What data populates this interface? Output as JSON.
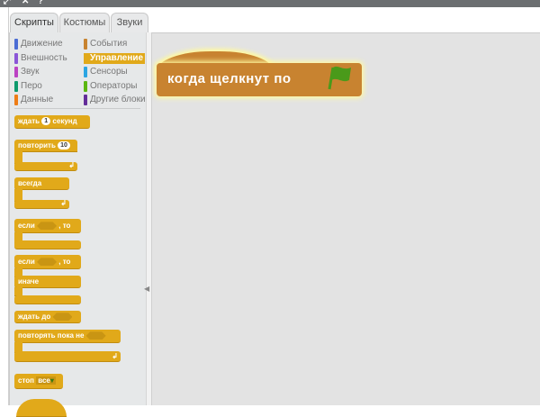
{
  "tabs": [
    {
      "label": "Скрипты"
    },
    {
      "label": "Костюмы"
    },
    {
      "label": "Звуки"
    }
  ],
  "categories": [
    {
      "label": "Движение",
      "color": "#4a6cd4"
    },
    {
      "label": "События",
      "color": "#c88330"
    },
    {
      "label": "Внешность",
      "color": "#8a55d7"
    },
    {
      "label": "Управление",
      "color": "#e1a91a"
    },
    {
      "label": "Звук",
      "color": "#bb42c3"
    },
    {
      "label": "Сенсоры",
      "color": "#2ca5e2"
    },
    {
      "label": "Перо",
      "color": "#0e9a6c"
    },
    {
      "label": "Операторы",
      "color": "#5cb712"
    },
    {
      "label": "Данные",
      "color": "#ee7d16"
    },
    {
      "label": "Другие блоки",
      "color": "#632d99"
    }
  ],
  "blocks": {
    "wait": {
      "label": "ждать",
      "value": "1",
      "suffix": "секунд"
    },
    "repeat": {
      "label": "повторить",
      "value": "10"
    },
    "forever": {
      "label": "всегда"
    },
    "if": {
      "label": "если",
      "suffix": ", то"
    },
    "ifelse": {
      "label": "если",
      "suffix": ", то",
      "else": "иначе"
    },
    "wait_until": {
      "label": "ждать до"
    },
    "repeat_until": {
      "label": "повторять пока не"
    },
    "stop": {
      "label": "стоп",
      "option": "все"
    }
  },
  "script": {
    "hat_label": "когда щелкнут по",
    "flag_color": "#4a9a1a"
  }
}
